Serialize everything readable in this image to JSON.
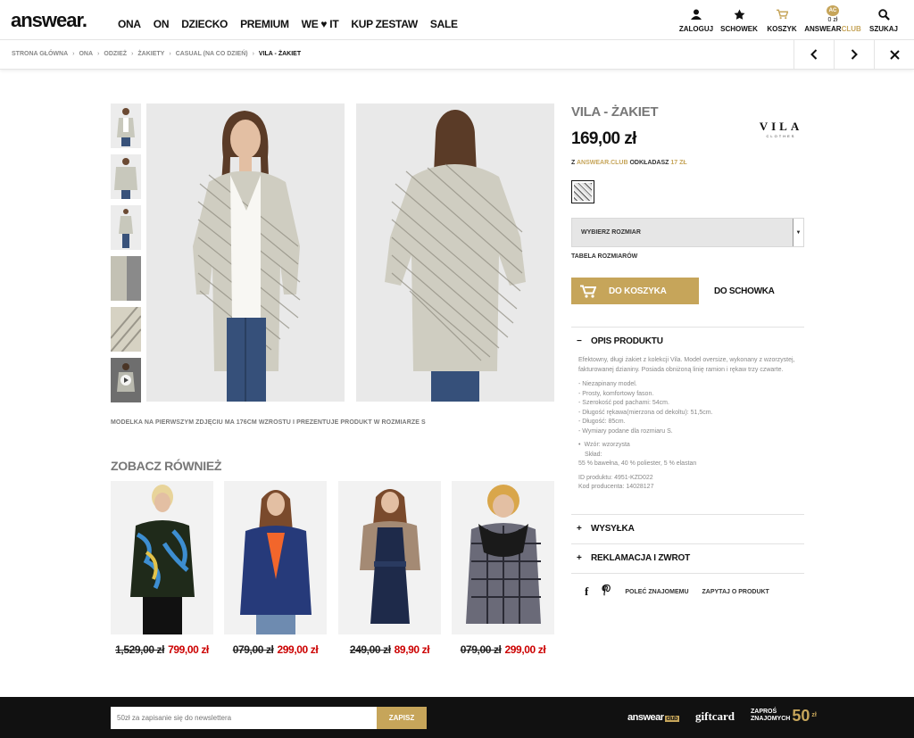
{
  "header": {
    "logo": "answear.",
    "nav": [
      "ONA",
      "ON",
      "DZIECKO",
      "PREMIUM",
      "WE ♥ IT",
      "KUP ZESTAW",
      "SALE"
    ],
    "user": {
      "login": "ZALOGUJ",
      "wishlist": "SCHOWEK",
      "cart": "KOSZYK",
      "club_badge": "AC",
      "club_amount": "0 zł",
      "club_label_a": "ANSWEAR",
      "club_label_b": "CLUB",
      "search": "SZUKAJ"
    }
  },
  "breadcrumb": [
    "STRONA GŁÓWNA",
    "ONA",
    "ODZIEŻ",
    "ŻAKIETY",
    "CASUAL (NA CO DZIEŃ)",
    "VILA - ŻAKIET"
  ],
  "product": {
    "title": "VILA - ŻAKIET",
    "price": "169,00 zł",
    "brand": "VILA",
    "brand_sub": "CLOTHES",
    "club_prefix": "Z",
    "club_name": "ANSWEAR.CLUB",
    "club_mid": "ODKŁADASZ",
    "club_amount": "17 ZŁ",
    "size_placeholder": "WYBIERZ ROZMIAR",
    "size_table": "TABELA ROZMIARÓW",
    "add_to_cart": "DO KOSZYKA",
    "add_to_wishlist": "DO SCHOWKA",
    "model_note": "MODELKA NA PIERWSZYM ZDJĘCIU MA 176CM WZROSTU I PREZENTUJE PRODUKT W ROZMIARZE S",
    "accordion": {
      "description_title": "OPIS PRODUKTU",
      "description_text": "Efektowny, długi żakiet z kolekcji Vila. Model oversize, wykonany z wzorzystej, fakturowanej dzianiny. Posiada obniżoną linię ramion i rękaw trzy czwarte.",
      "features": [
        "- Niezapinany model.",
        "- Prosty, komfortowy fason.",
        "- Szerokość pod pachami: 54cm.",
        "- Długość rękawa(mierzona od dekoltu): 51,5cm.",
        "- Długość: 85cm.",
        "- Wymiary podane dla rozmiaru S."
      ],
      "pattern": "Wzór: wzorzysta",
      "composition_label": "Skład:",
      "composition": "55 % bawełna, 40 % poliester, 5 % elastan",
      "product_id": "ID produktu: 4951-KZD022",
      "producer_code": "Kod producenta: 14028127",
      "shipping_title": "WYSYŁKA",
      "returns_title": "REKLAMACJA I ZWROT"
    },
    "share": {
      "recommend": "POLEĆ ZNAJOMEMU",
      "ask": "ZAPYTAJ O PRODUKT"
    }
  },
  "related": {
    "title": "ZOBACZ RÓWNIEŻ",
    "items": [
      {
        "old_price": "1,529,00 zł",
        "new_price": "799,00 zł"
      },
      {
        "old_price": "079,00 zł",
        "new_price": "299,00 zł"
      },
      {
        "old_price": "249,00 zł",
        "new_price": "89,90 zł"
      },
      {
        "old_price": "079,00 zł",
        "new_price": "299,00 zł"
      }
    ]
  },
  "footer": {
    "newsletter_placeholder": "50zł za zapisanie się do newslettera",
    "newsletter_button": "ZAPISZ",
    "logo_answear": "answear",
    "logo_club": "club",
    "giftcard": "giftcard",
    "invite_line1": "ZAPROŚ",
    "invite_line2": "ZNAJOMYCH",
    "invite_amount": "50",
    "invite_currency": "zł"
  },
  "colors": {
    "accent": "#c6a55a",
    "sale": "#cc0000",
    "footer_bg": "#111111"
  }
}
